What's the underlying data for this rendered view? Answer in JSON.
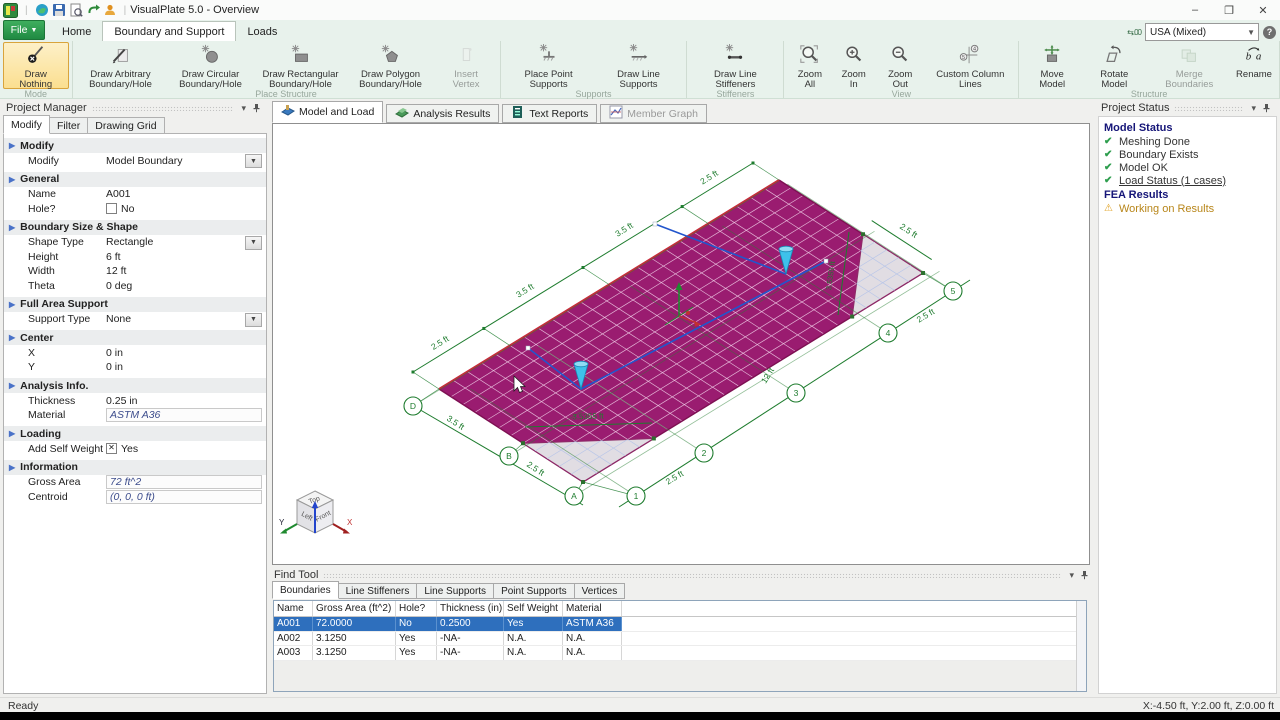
{
  "titlebar": {
    "app_title": "VisualPlate 5.0 - Overview",
    "window_controls": [
      {
        "name": "minimize",
        "glyph": "–"
      },
      {
        "name": "maximize",
        "glyph": "❐"
      },
      {
        "name": "close",
        "glyph": "✕"
      }
    ]
  },
  "ribbon": {
    "file_button": "File",
    "tabs": [
      {
        "label": "Home",
        "active": false
      },
      {
        "label": "Boundary and Support",
        "active": true
      },
      {
        "label": "Loads",
        "active": false
      }
    ],
    "units_value": "USA (Mixed)",
    "help_glyph": "?",
    "groups": [
      {
        "label": "Mode",
        "buttons": [
          {
            "label": "Draw Nothing",
            "icon": "draw-nothing-icon",
            "state": "selected"
          }
        ]
      },
      {
        "label": "Place Structure",
        "buttons": [
          {
            "label": "Draw Arbitrary Boundary/Hole",
            "icon": "draw-arbitrary-icon",
            "state": "normal"
          },
          {
            "label": "Draw Circular Boundary/Hole",
            "icon": "draw-circular-icon",
            "state": "normal"
          },
          {
            "label": "Draw Rectangular Boundary/Hole",
            "icon": "draw-rectangular-icon",
            "state": "normal"
          },
          {
            "label": "Draw Polygon Boundary/Hole",
            "icon": "draw-polygon-icon",
            "state": "normal"
          },
          {
            "label": "Insert Vertex",
            "icon": "insert-vertex-icon",
            "state": "disabled"
          }
        ]
      },
      {
        "label": "Supports",
        "buttons": [
          {
            "label": "Place Point Supports",
            "icon": "point-supports-icon",
            "state": "normal"
          },
          {
            "label": "Draw Line Supports",
            "icon": "line-supports-icon",
            "state": "normal"
          }
        ]
      },
      {
        "label": "Stiffeners",
        "buttons": [
          {
            "label": "Draw Line Stiffeners",
            "icon": "line-stiffeners-icon",
            "state": "normal"
          }
        ]
      },
      {
        "label": "View",
        "buttons": [
          {
            "label": "Zoom All",
            "icon": "zoom-all-icon",
            "state": "normal"
          },
          {
            "label": "Zoom In",
            "icon": "zoom-in-icon",
            "state": "normal"
          },
          {
            "label": "Zoom Out",
            "icon": "zoom-out-icon",
            "state": "normal"
          },
          {
            "label": "Custom Column Lines",
            "icon": "column-lines-icon",
            "state": "normal"
          }
        ]
      },
      {
        "label": "Structure",
        "buttons": [
          {
            "label": "Move Model",
            "icon": "move-model-icon",
            "state": "normal"
          },
          {
            "label": "Rotate Model",
            "icon": "rotate-model-icon",
            "state": "normal"
          },
          {
            "label": "Merge Boundaries",
            "icon": "merge-boundaries-icon",
            "state": "disabled"
          },
          {
            "label": "Rename",
            "icon": "rename-icon",
            "state": "normal"
          }
        ]
      }
    ]
  },
  "project_manager": {
    "title": "Project Manager",
    "tabs": [
      {
        "label": "Modify",
        "active": true
      },
      {
        "label": "Filter",
        "active": false
      },
      {
        "label": "Drawing Grid",
        "active": false
      }
    ],
    "sections": [
      {
        "header": "Modify",
        "rows": [
          {
            "label": "Modify",
            "value": "Model Boundary",
            "control": "dropdown"
          }
        ]
      },
      {
        "header": "General",
        "rows": [
          {
            "label": "Name",
            "value": "A001",
            "control": "text"
          },
          {
            "label": "Hole?",
            "value": "No",
            "control": "checkbox",
            "checked": false
          }
        ]
      },
      {
        "header": "Boundary Size & Shape",
        "rows": [
          {
            "label": "Shape Type",
            "value": "Rectangle",
            "control": "dropdown"
          },
          {
            "label": "Height",
            "value": "6 ft",
            "control": "text"
          },
          {
            "label": "Width",
            "value": "12 ft",
            "control": "text"
          },
          {
            "label": "Theta",
            "value": "0 deg",
            "control": "text"
          }
        ]
      },
      {
        "header": "Full Area Support",
        "rows": [
          {
            "label": "Support Type",
            "value": "None",
            "control": "dropdown"
          }
        ]
      },
      {
        "header": "Center",
        "rows": [
          {
            "label": "X",
            "value": "0 in",
            "control": "text"
          },
          {
            "label": "Y",
            "value": "0 in",
            "control": "text"
          }
        ]
      },
      {
        "header": "Analysis Info.",
        "rows": [
          {
            "label": "Thickness",
            "value": "0.25 in",
            "control": "text"
          },
          {
            "label": "Material",
            "value": "ASTM A36",
            "control": "box-italic"
          }
        ]
      },
      {
        "header": "Loading",
        "rows": [
          {
            "label": "Add Self Weight",
            "value": "Yes",
            "control": "checkbox",
            "checked": true
          }
        ]
      },
      {
        "header": "Information",
        "rows": [
          {
            "label": "Gross Area",
            "value": "72 ft^2",
            "control": "box-italic"
          },
          {
            "label": "Centroid",
            "value": "(0, 0, 0 ft)",
            "control": "box-italic"
          }
        ]
      }
    ]
  },
  "view": {
    "tabs": [
      {
        "label": "Model and Load",
        "icon": "model-load-tab-icon",
        "active": true,
        "disabled": false
      },
      {
        "label": "Analysis Results",
        "icon": "analysis-results-tab-icon",
        "active": false,
        "disabled": false
      },
      {
        "label": "Text Reports",
        "icon": "text-reports-tab-icon",
        "active": false,
        "disabled": false
      },
      {
        "label": "Member Graph",
        "icon": "member-graph-tab-icon",
        "active": false,
        "disabled": true
      }
    ],
    "scene_labels": {
      "top_dims": [
        "2.5 ft",
        "3.5 ft",
        "3.5 ft",
        "2.5 ft"
      ],
      "left_dims": [
        "3.5 ft",
        "2.5 ft"
      ],
      "bottom_dims": [
        "2.5 ft",
        "12 ft",
        "2.5 ft"
      ],
      "hole_dims": [
        "3.5355 ft",
        "2.5 ft",
        "3.5355 ft"
      ],
      "row_bubbles": [
        "D",
        "B",
        "A"
      ],
      "col_bubbles": [
        "1",
        "2",
        "3",
        "4",
        "5"
      ]
    },
    "cube": {
      "top": "Top",
      "left": "Left",
      "front": "Front",
      "axis_y": "Y",
      "axis_x": "X"
    }
  },
  "find_tool": {
    "title": "Find Tool",
    "tabs": [
      {
        "label": "Boundaries",
        "active": true
      },
      {
        "label": "Line Stiffeners",
        "active": false
      },
      {
        "label": "Line Supports",
        "active": false
      },
      {
        "label": "Point Supports",
        "active": false
      },
      {
        "label": "Vertices",
        "active": false
      }
    ],
    "table": {
      "headers": [
        "Name",
        "Gross Area (ft^2)",
        "Hole?",
        "Thickness (in)",
        "Self Weight",
        "Material"
      ],
      "rows": [
        {
          "cells": [
            "A001",
            "72.0000",
            "No",
            "0.2500",
            "Yes",
            "ASTM A36"
          ],
          "selected": true
        },
        {
          "cells": [
            "A002",
            "3.1250",
            "Yes",
            "-NA-",
            "N.A.",
            "N.A."
          ],
          "selected": false
        },
        {
          "cells": [
            "A003",
            "3.1250",
            "Yes",
            "-NA-",
            "N.A.",
            "N.A."
          ],
          "selected": false
        }
      ]
    }
  },
  "project_status": {
    "title": "Project Status",
    "sections": [
      {
        "header": "Model Status",
        "items": [
          {
            "text": "Meshing Done",
            "icon": "check",
            "underline": false
          },
          {
            "text": "Boundary Exists",
            "icon": "check",
            "underline": false
          },
          {
            "text": "Model OK",
            "icon": "check",
            "underline": false
          },
          {
            "text": "Load Status (1 cases)",
            "icon": "check",
            "underline": true
          }
        ]
      },
      {
        "header": "FEA Results",
        "items": [
          {
            "text": "Working on Results",
            "icon": "warning",
            "underline": false
          }
        ]
      }
    ]
  },
  "status_bar": {
    "left": "Ready",
    "right": "X:-4.50 ft, Y:2.00 ft, Z:0.00 ft"
  },
  "colors": {
    "plate": "#9a1c70",
    "hole_fill": "#e1dde3",
    "dimension_green": "#1e7c2e",
    "selection_blue": "#2e6fbd",
    "ribbon_green": "#e8f2ec",
    "selected_tool_orange": "#fbdf90",
    "load_cone_cyan": "#3ec1ea"
  }
}
